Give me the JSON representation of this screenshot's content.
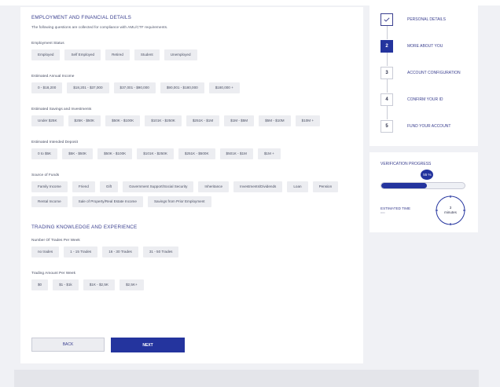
{
  "form": {
    "employment_title": "EMPLOYMENT AND FINANCIAL DETAILS",
    "employment_subtitle": "The following questions are collected for compliance with AML/CTF requirements.",
    "fields": [
      {
        "label": "Employment Status",
        "options": [
          "Employed",
          "Self Employed",
          "Retired",
          "Student",
          "Unemployed"
        ]
      },
      {
        "label": "Estimated Annual Income",
        "options": [
          "0 - $18,200",
          "$18,201 - $37,000",
          "$37,001 - $90,000",
          "$90,001 - $180,000",
          "$180,000 +"
        ]
      },
      {
        "label": "Estimated Savings and Investments",
        "options": [
          "Under $25K",
          "$25K - $50K",
          "$50K - $100K",
          "$101K - $250K",
          "$251K - $1M",
          "$1M - $5M",
          "$5M - $10M",
          "$10M +"
        ]
      },
      {
        "label": "Estimated Intended Deposit",
        "options": [
          "0 to $5K",
          "$5K - $50K",
          "$50K - $100K",
          "$101K - $250K",
          "$251K - $500K",
          "$501K - $1M",
          "$1M +"
        ]
      },
      {
        "label": "Source of Funds",
        "options": [
          "Family Income",
          "Friend",
          "Gift",
          "Government Support/Social Security",
          "Inheritance",
          "Investments/Dividends",
          "Loan",
          "Pension",
          "Rental Income",
          "Sale of Property/Real Estate Income",
          "Savings from Prior Employment"
        ]
      }
    ],
    "trading_title": "TRADING KNOWLEDGE AND EXPERIENCE",
    "trading_fields": [
      {
        "label": "Number Of Trades Per Week",
        "options": [
          "no trades",
          "1 - 15 Trades",
          "16 - 30 Trades",
          "31 - 50 Trades"
        ]
      },
      {
        "label": "Trading Amount Per Week",
        "options": [
          "$0",
          "$1 - $1k",
          "$1K - $2,5K",
          "$2,5K+"
        ]
      }
    ],
    "back_label": "BACK",
    "next_label": "NEXT"
  },
  "steps": [
    {
      "badge": "",
      "label": "PERSONAL DETAILS",
      "state": "done",
      "icon": "check-icon"
    },
    {
      "badge": "2",
      "label": "MORE ABOUT YOU",
      "state": "active"
    },
    {
      "badge": "3",
      "label": "ACCOUNT CONFIGURATION",
      "state": "pending"
    },
    {
      "badge": "4",
      "label": "CONFIRM YOUR ID",
      "state": "pending"
    },
    {
      "badge": "5",
      "label": "FUND YOUR ACCOUNT",
      "state": "pending"
    }
  ],
  "verification": {
    "title": "VERIFICATION PROGRESS",
    "progress_text": "55 %",
    "progress_value": 0.55,
    "time_label": "ESTIMATED TIME",
    "time_sub": "•••••",
    "time_value": "3",
    "time_unit": "minutes"
  },
  "colors": {
    "accent": "#24349e",
    "heading": "#3a3f8f",
    "chip_bg": "#ecedf1",
    "page_bg": "#f0f1f5"
  }
}
